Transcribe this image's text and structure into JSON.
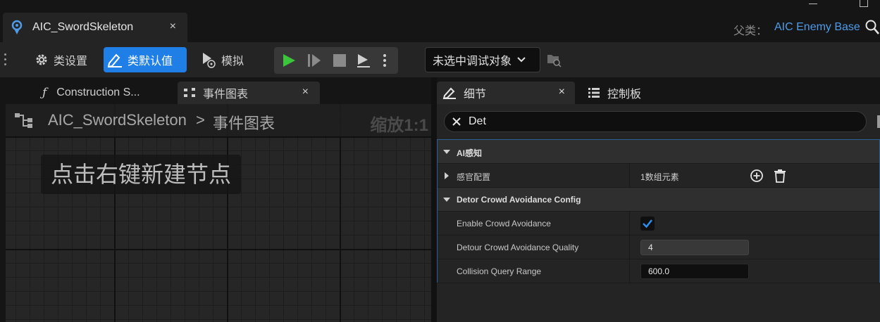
{
  "window": {
    "tab_title": "AIC_SwordSkeleton",
    "tab_close": "×",
    "parent_label": "父类：",
    "parent_value": "AIC Enemy Base"
  },
  "toolbar": {
    "class_settings": "类设置",
    "class_defaults": "类默认值",
    "simulate": "模拟",
    "debug_object": "未选中调试对象"
  },
  "graph": {
    "tabs": [
      {
        "label": "Construction S..."
      },
      {
        "label": "事件图表",
        "close": "×"
      }
    ],
    "breadcrumb_root": "AIC_SwordSkeleton",
    "breadcrumb_sep": ">",
    "breadcrumb_current": "事件图表",
    "zoom": "缩放1:1",
    "hint": "点击右键新建节点"
  },
  "details": {
    "tabs": [
      {
        "label": "细节",
        "close": "×"
      },
      {
        "label": "控制板"
      }
    ],
    "search_value": "Det",
    "categories": [
      {
        "label": "AI感知",
        "rows": [
          {
            "label": "感官配置",
            "value": "1数组元素"
          }
        ]
      },
      {
        "label": "Detor Crowd Avoidance Config",
        "rows": [
          {
            "label": "Enable Crowd Avoidance",
            "checked": true
          },
          {
            "label": "Detour Crowd Avoidance Quality",
            "value": "4"
          },
          {
            "label": "Collision Query Range",
            "value": "600.0"
          }
        ]
      }
    ]
  },
  "colors": {
    "accent": "#1f7fe6",
    "link": "#4f9be8",
    "play_green": "#3cc43c",
    "panel": "#242424",
    "background": "#151515"
  },
  "icons": [
    "blueprint-icon",
    "gear-icon",
    "class-defaults-icon",
    "simulate-icon",
    "play-icon",
    "step-icon",
    "stop-icon",
    "eject-icon",
    "more-icon",
    "chevron-down-icon",
    "find-icon",
    "function-icon",
    "graph-icon",
    "pencil-icon",
    "palette-icon",
    "close-icon",
    "add-icon",
    "trash-icon",
    "checkmark-icon",
    "search-icon"
  ]
}
